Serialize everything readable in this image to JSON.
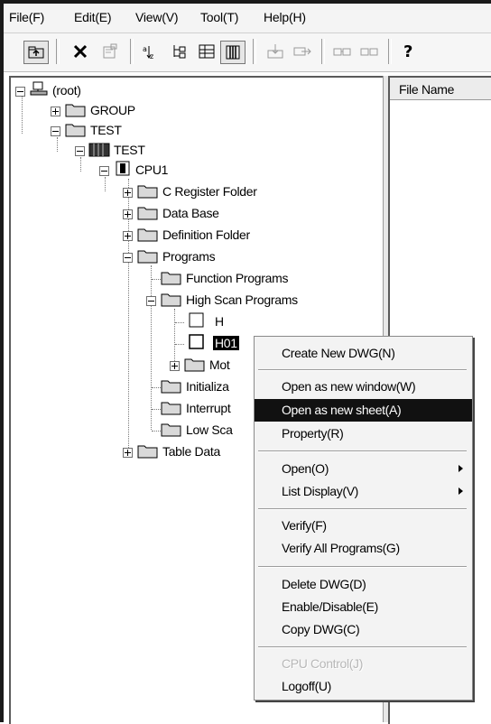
{
  "menubar": {
    "file": "File(F)",
    "edit": "Edit(E)",
    "view": "View(V)",
    "tool": "Tool(T)",
    "help": "Help(H)"
  },
  "toolbar": {
    "buttons": [
      "folder-up-icon",
      "delete-icon",
      "properties-icon",
      "sort-icon",
      "tree-icon",
      "details-icon",
      "list-icon",
      "import-icon",
      "export-icon",
      "connect-icon",
      "disconnect-icon",
      "help-icon"
    ]
  },
  "list": {
    "column_file_name": "File Name"
  },
  "tree": {
    "root": "(root)",
    "group": "GROUP",
    "test_folder": "TEST",
    "test_cpu_group": "TEST",
    "cpu1": "CPU1",
    "c_register": "C Register Folder",
    "data_base": "Data Base",
    "definition": "Definition Folder",
    "programs": "Programs",
    "function_programs": "Function Programs",
    "high_scan": "High Scan Programs",
    "h": "H",
    "h01": "H01",
    "motion": "Mot",
    "initialize": "Initializa",
    "interrupt": "Interrupt",
    "low_scan": "Low Sca",
    "table_data": "Table Data"
  },
  "context_menu": {
    "items": [
      {
        "label": "Create New DWG(N)"
      },
      {
        "label": "Open as new window(W)"
      },
      {
        "label": "Open as new sheet(A)"
      },
      {
        "label": "Property(R)"
      },
      {
        "label": "Open(O)"
      },
      {
        "label": "List Display(V)"
      },
      {
        "label": "Verify(F)"
      },
      {
        "label": "Verify All Programs(G)"
      },
      {
        "label": "Delete DWG(D)"
      },
      {
        "label": "Enable/Disable(E)"
      },
      {
        "label": "Copy DWG(C)"
      },
      {
        "label": "CPU Control(J)"
      },
      {
        "label": "Logoff(U)"
      }
    ],
    "highlighted": "Open as new sheet(A)",
    "disabled": "CPU Control(J)"
  },
  "colors": {
    "highlight": "#111111",
    "menu_bg": "#f3f3f3",
    "folder": "#d9d9d9"
  }
}
